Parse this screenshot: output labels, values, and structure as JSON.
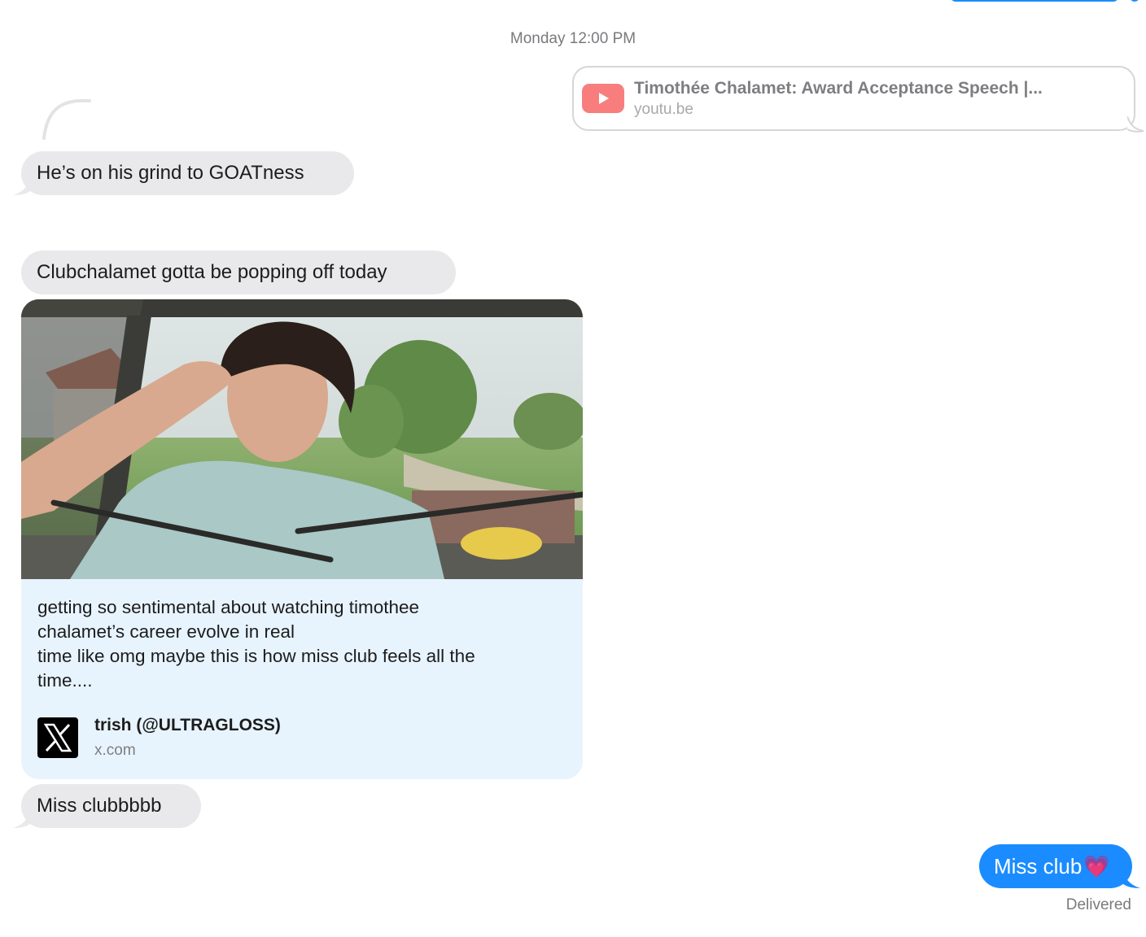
{
  "conversation": {
    "timestamp": "Monday 12:00 PM",
    "youtube_link": {
      "title": "Timothée Chalamet: Award Acceptance Speech |...",
      "domain": "youtu.be",
      "icon": "youtube-play-icon"
    },
    "messages": [
      {
        "text": "He’s on his grind to GOATness"
      },
      {
        "text": "Clubchalamet gotta be popping off today"
      },
      {
        "text": "Miss clubbbbb"
      }
    ],
    "tweet_card": {
      "text": "getting so sentimental about watching timothee\nchalamet’s career evolve in real\ntime like omg maybe this is how miss club feels all the\ntime....",
      "author": "trish (@ULTRAGLOSS)",
      "domain": "x.com",
      "icon": "x-logo-icon"
    },
    "sent_message": {
      "text": "Miss club",
      "emoji": "💗"
    },
    "status": "Delivered"
  },
  "colors": {
    "outgoing_bubble": "#1a8cff",
    "incoming_bubble": "#e9e9eb",
    "tweet_card_bg": "#e8f4fd",
    "youtube_red": "#f87e7e"
  }
}
